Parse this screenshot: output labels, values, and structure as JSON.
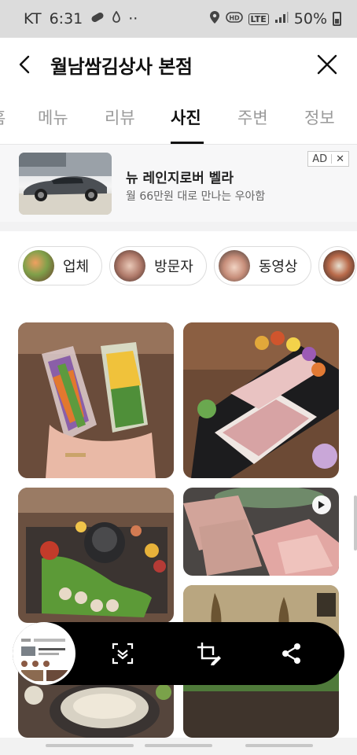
{
  "status_bar": {
    "carrier": "KT",
    "time": "6:31",
    "dots": "··",
    "lte": "LTE",
    "battery": "50%"
  },
  "header": {
    "title": "월남쌈김상사 본점"
  },
  "tabs": [
    "홈",
    "메뉴",
    "리뷰",
    "사진",
    "주변",
    "정보"
  ],
  "active_tab": "사진",
  "ad": {
    "title": "뉴 레인지로버 벨라",
    "subtitle": "월 66만원 대로 만나는 우아함",
    "badge": "AD",
    "badge_close": "✕"
  },
  "filter_chips": [
    "업체",
    "방문자",
    "동영상"
  ],
  "colors": {
    "accent": "#111111",
    "tab_inactive": "#9a9a9a",
    "toolbar": "#000000"
  },
  "photos": [
    {
      "desc_icon": "photo-spring-rolls"
    },
    {
      "desc_icon": "photo-meat-platter"
    },
    {
      "desc_icon": "photo-table-spread"
    },
    {
      "desc_icon": "photo-video-meat",
      "video": true
    },
    {
      "desc_icon": "photo-interior"
    },
    {
      "desc_icon": "photo-hotpot"
    }
  ]
}
